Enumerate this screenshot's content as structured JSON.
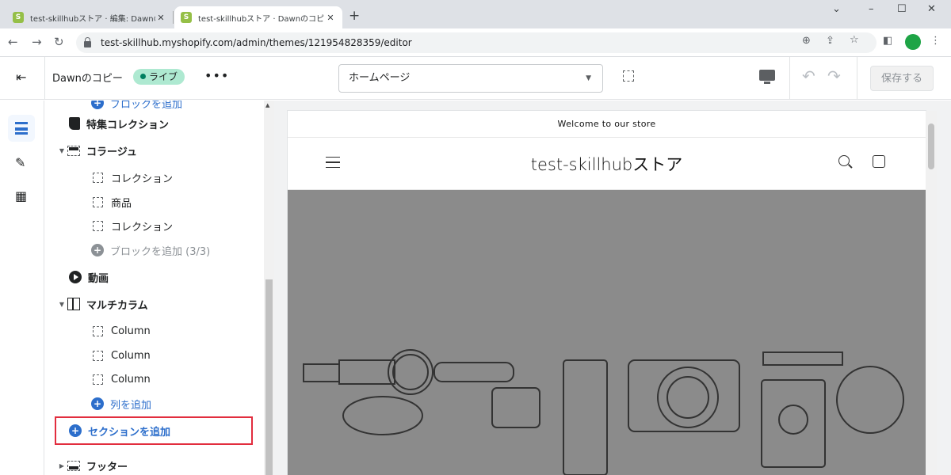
{
  "browser": {
    "tabs": [
      {
        "title": "test-skillhubストア · 編集: Dawnの",
        "active": false
      },
      {
        "title": "test-skillhubストア · Dawnのコピーを",
        "active": true
      }
    ],
    "url": "test-skillhub.myshopify.com/admin/themes/121954828359/editor",
    "new_tab": "+",
    "window_controls": [
      "⌄",
      "–",
      "☐",
      "✕"
    ]
  },
  "editor": {
    "theme_name": "Dawnのコピー",
    "live_badge": "ライブ",
    "more": "•••",
    "page_select": "ホームページ",
    "save_label": "保存する"
  },
  "tree": {
    "items": [
      {
        "label": "ブロックを追加",
        "type": "add"
      },
      {
        "label": "特集コレクション",
        "type": "section",
        "icon": "tag-icon"
      },
      {
        "label": "コラージュ",
        "type": "section",
        "icon": "collage-icon"
      },
      {
        "label": "コレクション",
        "type": "block"
      },
      {
        "label": "商品",
        "type": "block"
      },
      {
        "label": "コレクション",
        "type": "block"
      },
      {
        "label": "ブロックを追加 (3/3)",
        "type": "add-disabled"
      },
      {
        "label": "動画",
        "type": "section",
        "icon": "video-icon"
      },
      {
        "label": "マルチカラム",
        "type": "section",
        "icon": "columns-icon"
      },
      {
        "label": "Column",
        "type": "block"
      },
      {
        "label": "Column",
        "type": "block"
      },
      {
        "label": "Column",
        "type": "block"
      },
      {
        "label": "列を追加",
        "type": "add-blue"
      },
      {
        "label": "セクションを追加",
        "type": "add-section"
      },
      {
        "label": "フッター",
        "type": "section",
        "icon": "footer-icon"
      }
    ]
  },
  "preview": {
    "announcement": "Welcome to our store",
    "store_name": "test-skillhubストア"
  },
  "colors": {
    "accent": "#2c6ecb",
    "live_badge": "#aee9d1",
    "highlight": "#e22d3e",
    "hero": "#8b8b8b"
  }
}
